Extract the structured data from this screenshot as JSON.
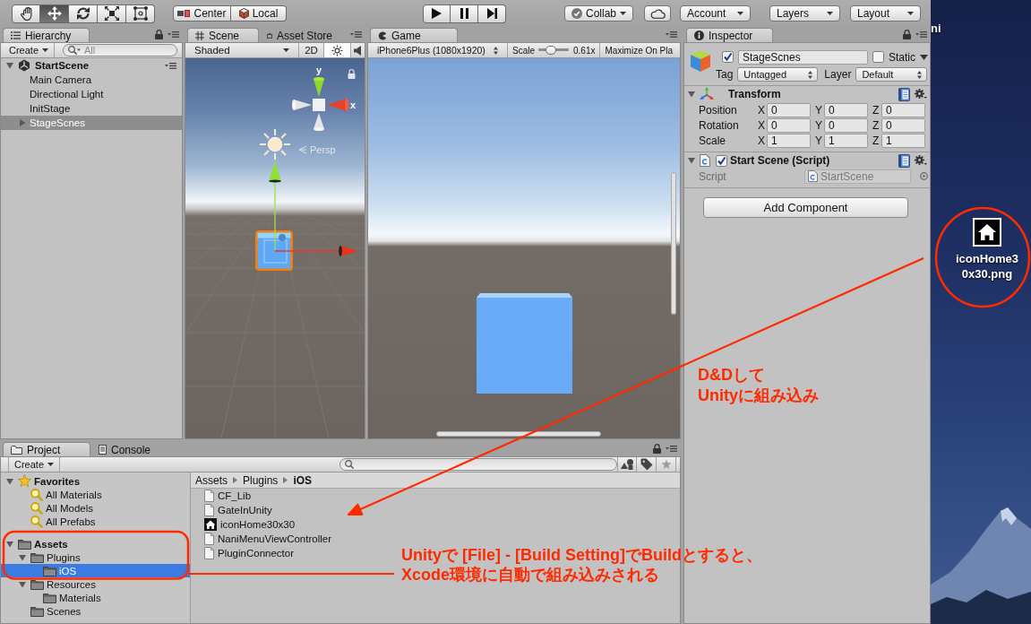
{
  "toolbar": {
    "tools": [
      {
        "kind": "hand",
        "selected": false
      },
      {
        "kind": "move",
        "selected": true
      },
      {
        "kind": "rotate",
        "selected": false
      },
      {
        "kind": "scale",
        "selected": false
      },
      {
        "kind": "rect",
        "selected": false
      }
    ],
    "pivot_mode": "Center",
    "pivot_rotation": "Local",
    "collab": "Collab",
    "account": "Account",
    "layers": "Layers",
    "layout": "Layout"
  },
  "hierarchy": {
    "tabs": [
      {
        "label": "Hierarchy",
        "selected": true
      }
    ],
    "create": "Create",
    "search": {
      "placeholder": "All"
    },
    "scene": {
      "name": "StartScene",
      "expanded": true,
      "children": [
        {
          "name": "Main Camera",
          "selected": false
        },
        {
          "name": "Directional Light",
          "selected": false
        },
        {
          "name": "InitStage",
          "selected": false
        },
        {
          "name": "StageScnes",
          "selected": true,
          "expanded": false
        }
      ]
    }
  },
  "scene": {
    "tabs": [
      {
        "label": "Scene",
        "selected": true
      },
      {
        "label": "Asset Store",
        "selected": false
      }
    ],
    "shading": "Shaded",
    "mode_2d": "2D",
    "lighting_on": true,
    "gizmo": {
      "y_label": "y",
      "x_label": "x",
      "projection": "Persp"
    }
  },
  "game": {
    "tabs": [
      {
        "label": "Game",
        "selected": true
      }
    ],
    "resolution": "iPhone6Plus (1080x1920)",
    "scale_label": "Scale",
    "scale": {
      "level": 0.35
    },
    "scale_reading": "0.61x",
    "maximize": "Maximize On Pla"
  },
  "inspector": {
    "tabs": [
      {
        "label": "Inspector",
        "selected": true
      }
    ],
    "object": {
      "active": true,
      "name": "StageScnes",
      "static": false,
      "static_label": "Static",
      "tag_label": "Tag",
      "tag": "Untagged",
      "layer_label": "Layer",
      "layer": "Default"
    },
    "components": [
      {
        "kind": "transform",
        "title": "Transform",
        "expanded": true,
        "rows": [
          {
            "label": "Position",
            "values": [
              {
                "axis": "X",
                "value": "0"
              },
              {
                "axis": "Y",
                "value": "0"
              },
              {
                "axis": "Z",
                "value": "0"
              }
            ]
          },
          {
            "label": "Rotation",
            "values": [
              {
                "axis": "X",
                "value": "0"
              },
              {
                "axis": "Y",
                "value": "0"
              },
              {
                "axis": "Z",
                "value": "0"
              }
            ]
          },
          {
            "label": "Scale",
            "values": [
              {
                "axis": "X",
                "value": "1"
              },
              {
                "axis": "Y",
                "value": "1"
              },
              {
                "axis": "Z",
                "value": "1"
              }
            ]
          }
        ]
      },
      {
        "kind": "script",
        "title": "Start Scene (Script)",
        "expanded": true,
        "enabled": true,
        "fields": [
          {
            "label": "Script",
            "value": "StartScene",
            "disabled": true
          }
        ]
      }
    ],
    "add_component": "Add Component"
  },
  "project": {
    "tabs": [
      {
        "label": "Project",
        "selected": true
      },
      {
        "label": "Console",
        "selected": false
      }
    ],
    "create": "Create",
    "tree": [
      {
        "name": "Favorites",
        "kind": "favorites",
        "selected": false,
        "expanded": true,
        "children": [
          {
            "name": "All Materials",
            "kind": "search",
            "selected": false
          },
          {
            "name": "All Models",
            "kind": "search",
            "selected": false
          },
          {
            "name": "All Prefabs",
            "kind": "search",
            "selected": false
          }
        ]
      },
      {
        "name": "Assets",
        "kind": "folder",
        "selected": false,
        "expanded": true,
        "children": [
          {
            "name": "Plugins",
            "kind": "folder",
            "selected": false,
            "expanded": true,
            "children": [
              {
                "name": "iOS",
                "kind": "folder",
                "selected": true
              }
            ]
          },
          {
            "name": "Resources",
            "kind": "folder",
            "selected": false,
            "expanded": true,
            "children": [
              {
                "name": "Materials",
                "kind": "folder",
                "selected": false
              }
            ]
          },
          {
            "name": "Scenes",
            "kind": "folder",
            "selected": false
          }
        ]
      }
    ],
    "breadcrumb": [
      "Assets",
      "Plugins",
      "iOS"
    ],
    "files": [
      {
        "name": "CF_Lib",
        "kind": "file",
        "selected": false
      },
      {
        "name": "GateInUnity",
        "kind": "file",
        "selected": false
      },
      {
        "name": "iconHome30x30",
        "kind": "image",
        "selected": false
      },
      {
        "name": "NaniMenuViewController",
        "kind": "file",
        "selected": false
      },
      {
        "name": "PluginConnector",
        "kind": "file",
        "selected": false
      }
    ]
  },
  "desktop": {
    "partial_label": "ni",
    "file": {
      "label_lines": [
        "iconHome3",
        "0x30.png"
      ]
    }
  },
  "annotations": [
    {
      "lines": [
        "D&Dして",
        "Unityに組み込み"
      ]
    },
    {
      "lines": [
        "Unityで [File] - [Build Setting]でBuildとすると、",
        "Xcode環境に自動で組み込みされる"
      ]
    }
  ]
}
